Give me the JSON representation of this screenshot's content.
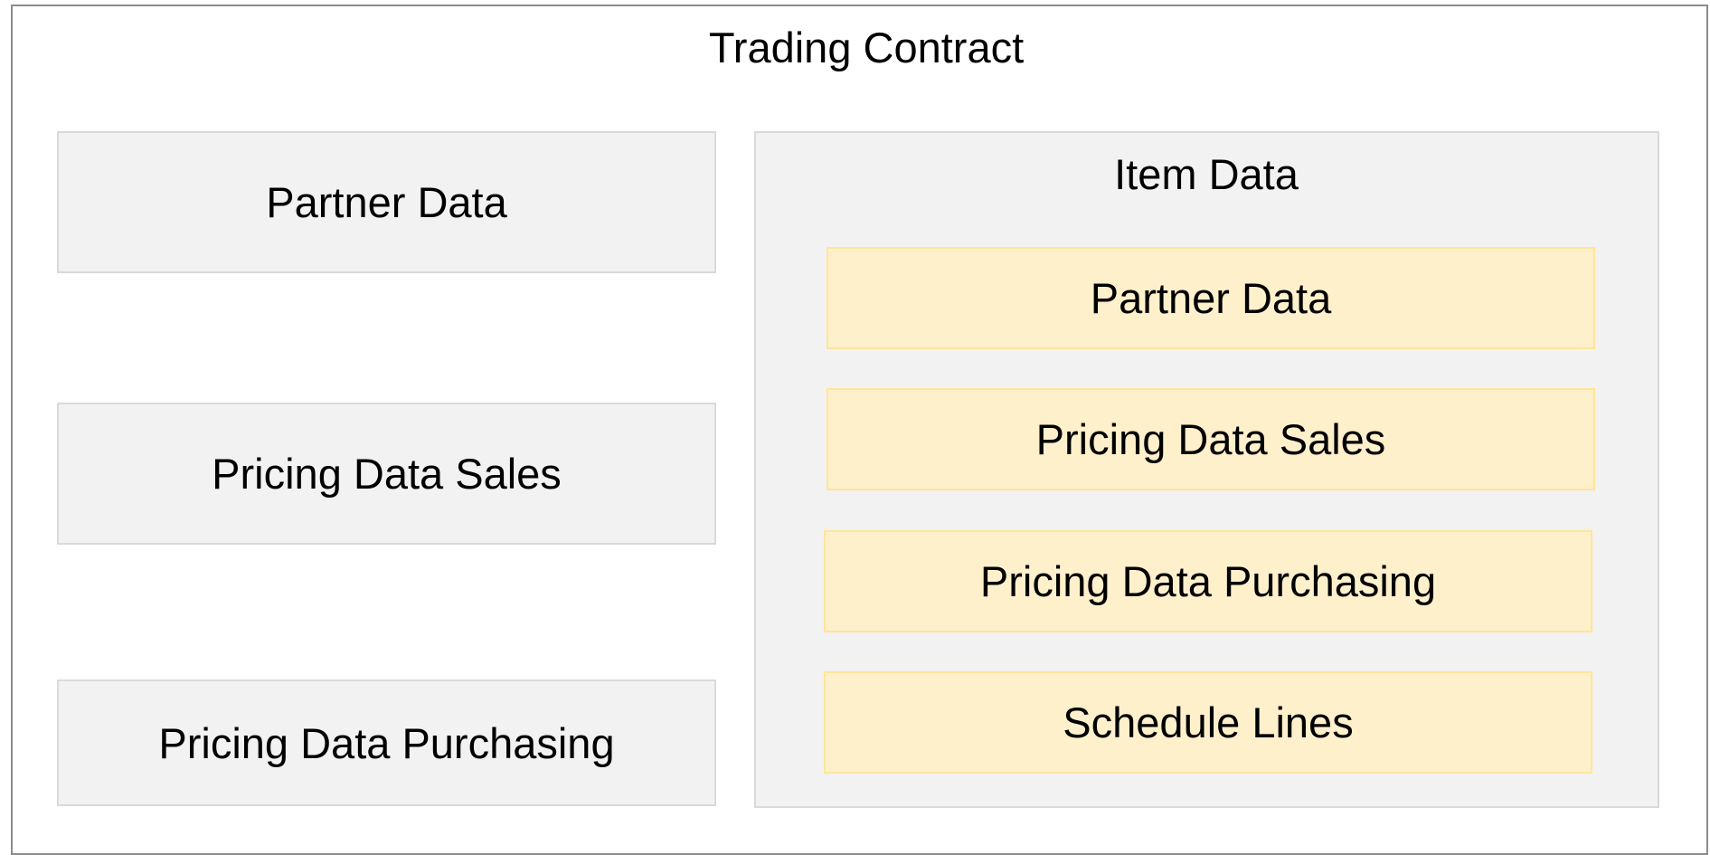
{
  "diagram": {
    "title": "Trading Contract",
    "left_boxes": [
      {
        "label": "Partner Data"
      },
      {
        "label": "Pricing Data Sales"
      },
      {
        "label": "Pricing Data Purchasing"
      }
    ],
    "item_data": {
      "title": "Item Data",
      "boxes": [
        {
          "label": "Partner Data"
        },
        {
          "label": "Pricing Data Sales"
        },
        {
          "label": "Pricing Data Purchasing"
        },
        {
          "label": "Schedule Lines"
        }
      ]
    },
    "colors": {
      "grey_fill": "#f2f2f2",
      "grey_border": "#d9d9d9",
      "yellow_fill": "#fff0cc",
      "yellow_border": "#ffe599",
      "frame_border": "#8c8c8c"
    }
  }
}
